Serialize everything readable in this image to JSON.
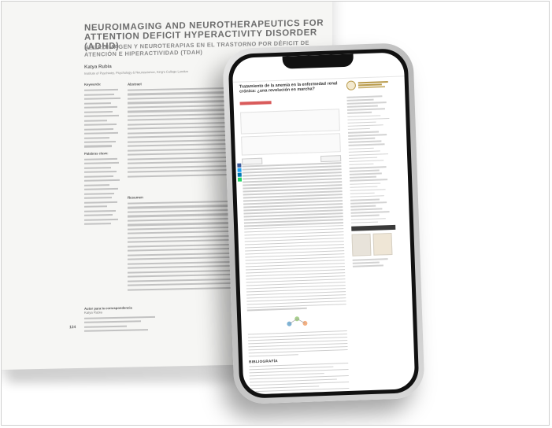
{
  "book": {
    "title_line": "NEUROIMAGING AND NEUROTHERAPEUTICS FOR ATTENTION DEFICIT HYPERACTIVITY DISORDER (ADHD)",
    "subtitle_line": "NEUROIMAGEN Y NEUROTERAPIAS EN EL TRASTORNO POR DÉFICIT DE ATENCIÓN E HIPERACTIVIDAD (TDAH)",
    "author": "Katya Rubia",
    "affiliation": "Institute of Psychiatry, Psychology & Neuroscience, King's College London",
    "keywords_heading": "Keywords:",
    "abstract_heading": "Abstract",
    "palabras_heading": "Palabras clave:",
    "resumen_heading": "Resumen",
    "correspondence_heading": "Autor para la correspondencia",
    "correspondence_name": "Katya Rubia",
    "page_number": "124"
  },
  "phone": {
    "article_title": "Tratamiento de la anemia en la enfermedad renal crónica: ¿una revolución en marcha?",
    "bibliography_heading": "BIBLIOGRAFÍA"
  }
}
